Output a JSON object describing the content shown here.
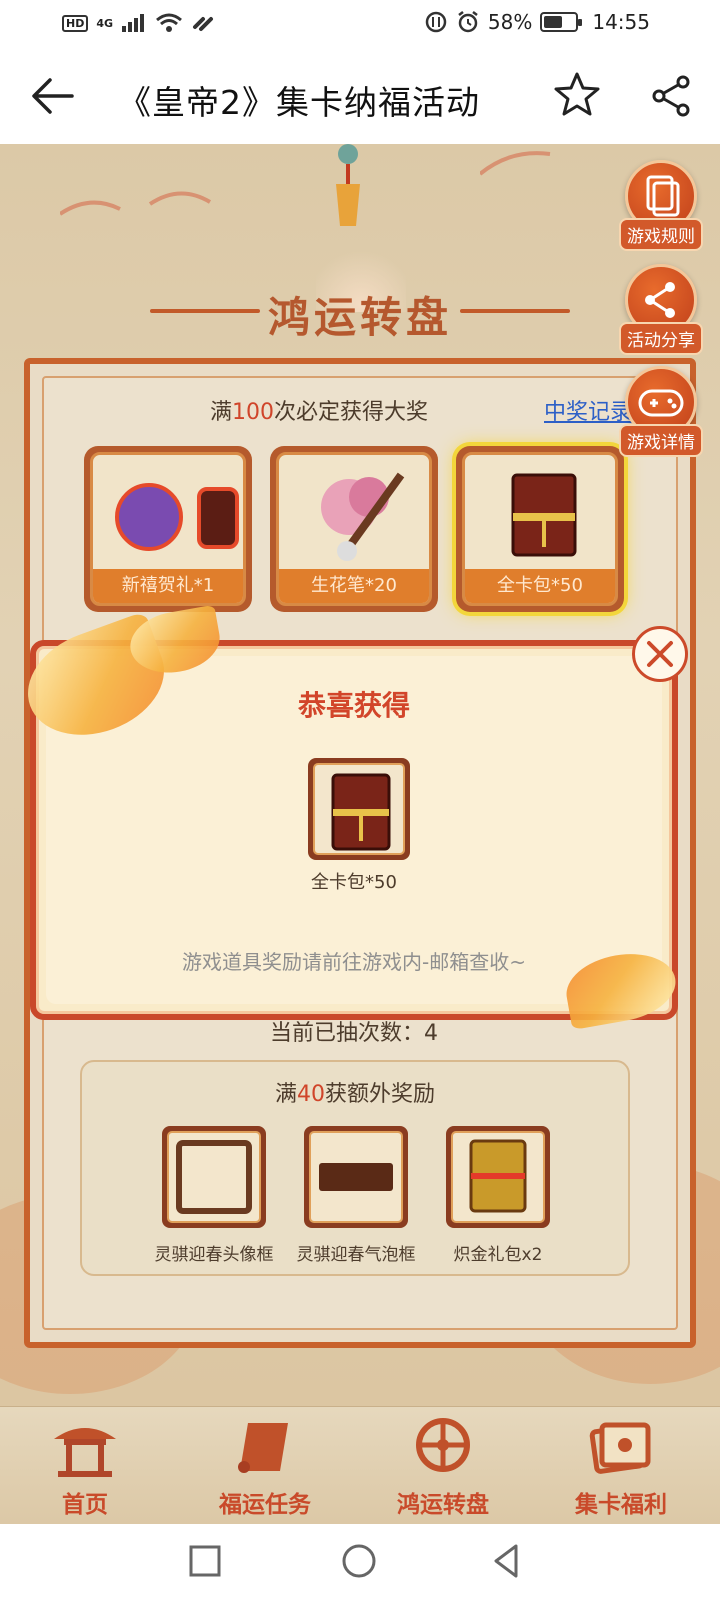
{
  "status_bar": {
    "hd": "HD",
    "network": "4G",
    "battery_percent": "58%",
    "battery_level": 0.58,
    "time": "14:55"
  },
  "header": {
    "title": "《皇帝2》集卡纳福活动"
  },
  "page": {
    "wheel_title": "鸿运转盘",
    "top_text_prefix": "满",
    "top_text_count": "100",
    "top_text_suffix": "次必定获得大奖",
    "record_link": "中奖记录",
    "prizes": [
      {
        "label": "新禧贺礼*1"
      },
      {
        "label": "生花笔*20"
      },
      {
        "label": "全卡包*50"
      }
    ],
    "fabs": [
      {
        "label": "游戏规则",
        "icon": "document-icon"
      },
      {
        "label": "活动分享",
        "icon": "share-icon"
      },
      {
        "label": "游戏详情",
        "icon": "gamepad-icon"
      }
    ],
    "count_text": "当前已抽次数：4",
    "bonus": {
      "title_prefix": "满",
      "title_count": "40",
      "title_suffix": "获额外奖励",
      "items": [
        {
          "label": "灵骐迎春头像框"
        },
        {
          "label": "灵骐迎春气泡框"
        },
        {
          "label": "炽金礼包x2"
        }
      ]
    }
  },
  "modal": {
    "title": "恭喜获得",
    "item_label": "全卡包*50",
    "note": "游戏道具奖励请前往游戏内-邮箱查收~"
  },
  "bottom_nav": [
    {
      "label": "首页",
      "icon": "pavilion-icon"
    },
    {
      "label": "福运任务",
      "icon": "scroll-icon"
    },
    {
      "label": "鸿运转盘",
      "icon": "wheel-icon"
    },
    {
      "label": "集卡福利",
      "icon": "cards-icon"
    }
  ],
  "colors": {
    "accent": "#c94a2a",
    "title_red": "#d2452a",
    "link_blue": "#2c5fc7"
  }
}
